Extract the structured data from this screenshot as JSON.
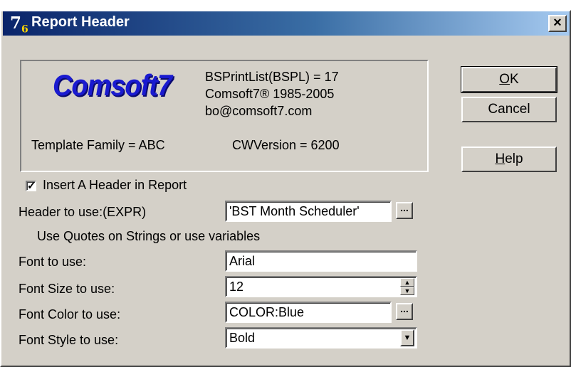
{
  "window": {
    "title": "Report Header",
    "icon_glyph": "7",
    "icon_sub": "6",
    "close_glyph": "×"
  },
  "about": {
    "logo": "Comsoft7",
    "line1": "BSPrintList(BSPL) = 17",
    "line2": "Comsoft7® 1985-2005",
    "line3": "bo@comsoft7.com",
    "template_family": "Template Family = ABC",
    "cw_version": "CWVersion = 6200"
  },
  "buttons": {
    "ok_prefix": "",
    "ok_mnemonic": "O",
    "ok_rest": "K",
    "cancel": "Cancel",
    "help_mnemonic": "H",
    "help_rest": "elp"
  },
  "form": {
    "insert_header_label": "Insert A Header in Report",
    "insert_header_checked": true,
    "header_label": "Header to use:(EXPR)",
    "header_value": "'BST Month Scheduler'",
    "hint": "Use Quotes on Strings or use variables",
    "font_label": "Font to use:",
    "font_value": "Arial",
    "font_size_label": "Font Size to use:",
    "font_size_value": "12",
    "font_color_label": "Font Color to use:",
    "font_color_value": "COLOR:Blue",
    "font_style_label": "Font Style to use:",
    "font_style_value": "Bold",
    "ellipsis": "..."
  },
  "icons": {
    "checkmark": "check-icon",
    "spin_up": "spin-up-icon",
    "spin_down": "spin-down-icon",
    "dropdown": "dropdown-arrow-icon"
  },
  "colors": {
    "titlebar_start": "#0a246a",
    "titlebar_end": "#a6caf0",
    "dialog_face": "#d4d0c8",
    "logo": "#1a1ad0"
  }
}
